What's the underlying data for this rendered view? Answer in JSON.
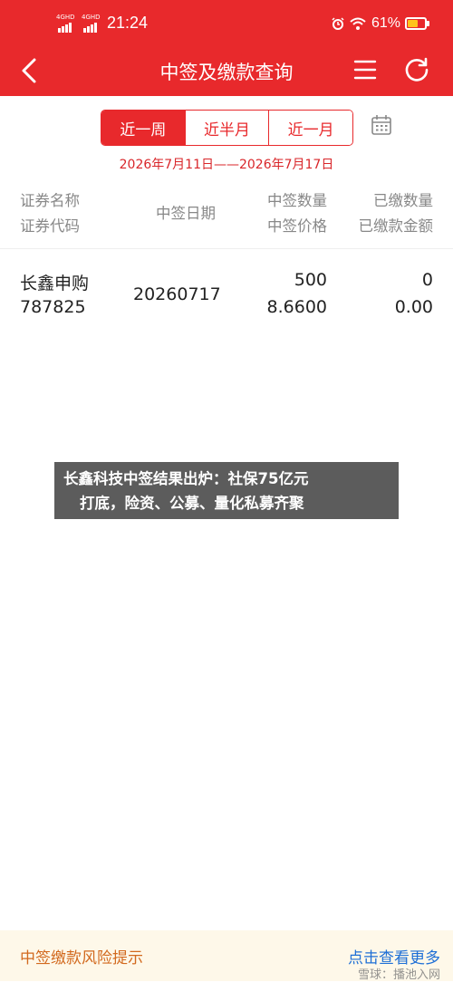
{
  "status_bar": {
    "sim1_label": "4GHD",
    "sim2_label": "4GHD",
    "time": "21:24",
    "battery_pct": "61%",
    "battery_level": 0.61
  },
  "header": {
    "title": "中签及缴款查询",
    "icons": [
      "back-icon",
      "menu-icon",
      "refresh-icon"
    ]
  },
  "filter": {
    "tabs": [
      {
        "label": "近一周",
        "active": true
      },
      {
        "label": "近半月",
        "active": false
      },
      {
        "label": "近一月",
        "active": false
      }
    ],
    "range_text": "2026年7月11日——2026年7月17日"
  },
  "table": {
    "headers": {
      "name": "证券名称",
      "code": "证券代码",
      "date": "中签日期",
      "qty": "中签数量",
      "price": "中签价格",
      "paid_qty": "已缴数量",
      "paid_amount": "已缴款金额"
    },
    "rows": [
      {
        "name": "长鑫申购",
        "code": "787825",
        "date": "20260717",
        "qty": "500",
        "price": "8.6600",
        "paid_qty": "0",
        "paid_amount": "0.00"
      }
    ]
  },
  "banner": {
    "line1": "长鑫科技中签结果出炉：社保75亿元",
    "line2": "打底，险资、公募、量化私募齐聚"
  },
  "footer": {
    "risk_label": "中签缴款风险提示",
    "more_label": "点击查看更多",
    "watermark": "雪球：播池入网"
  },
  "colors": {
    "brand_red": "#e8292c",
    "footer_bg": "#fef8e9",
    "link_blue": "#1e6fd6",
    "warn_orange": "#d2691e"
  }
}
